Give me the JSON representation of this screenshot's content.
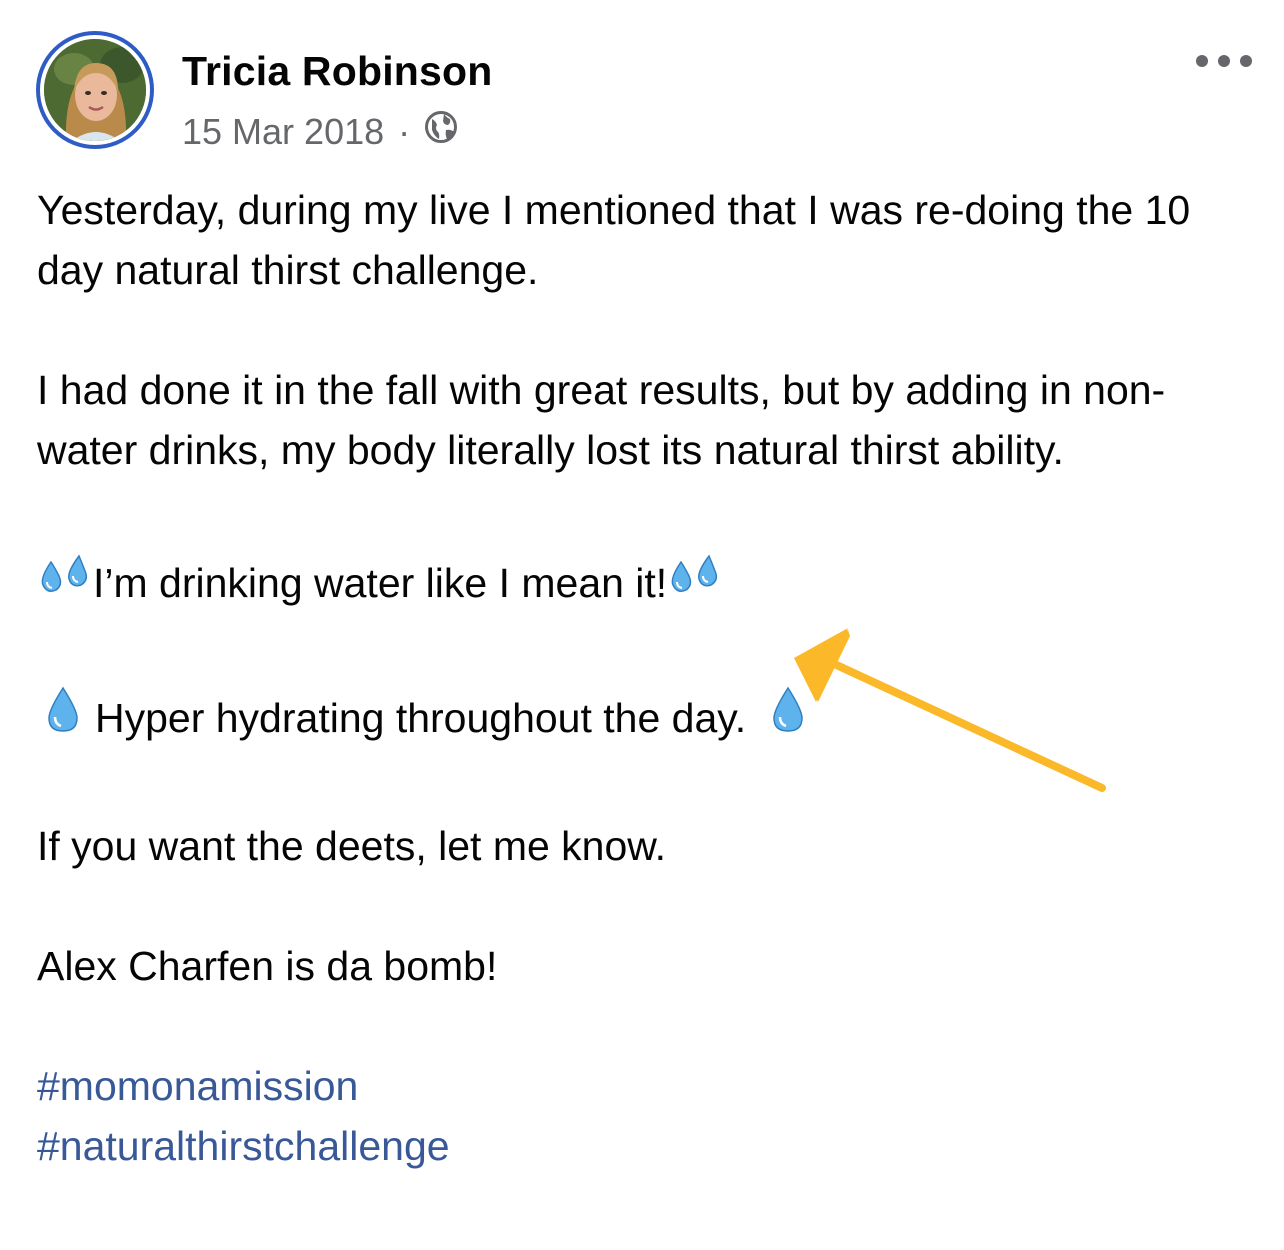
{
  "post": {
    "author": "Tricia Robinson",
    "date": "15 Mar 2018",
    "separator": "·",
    "privacy_icon": "globe-icon",
    "more_icon": "ellipsis-icon",
    "paragraphs": {
      "p1": "Yesterday, during my live I mentioned that I was re-doing the 10 day natural thirst challenge.",
      "p2": "I had done it in the fall with great results, but by adding in non-water drinks, my body literally lost its natural thirst ability.",
      "p3": "I’m drinking water like I mean it!",
      "p4": "Hyper hydrating throughout the day.",
      "p5": "If you want the deets, let me know.",
      "p6": "Alex Charfen is da bomb!"
    },
    "hashtags": [
      "#momonamission",
      "#naturalthirstchallenge"
    ],
    "emoji": {
      "sweat_droplets": "sweat-droplets-icon",
      "droplet": "droplet-icon"
    }
  },
  "annotation": {
    "arrow_color": "#fbb829",
    "arrow_icon": "arrow-icon"
  },
  "colors": {
    "accent": "#2f5cc4",
    "hashtag": "#385898",
    "secondary_text": "#65676b"
  }
}
